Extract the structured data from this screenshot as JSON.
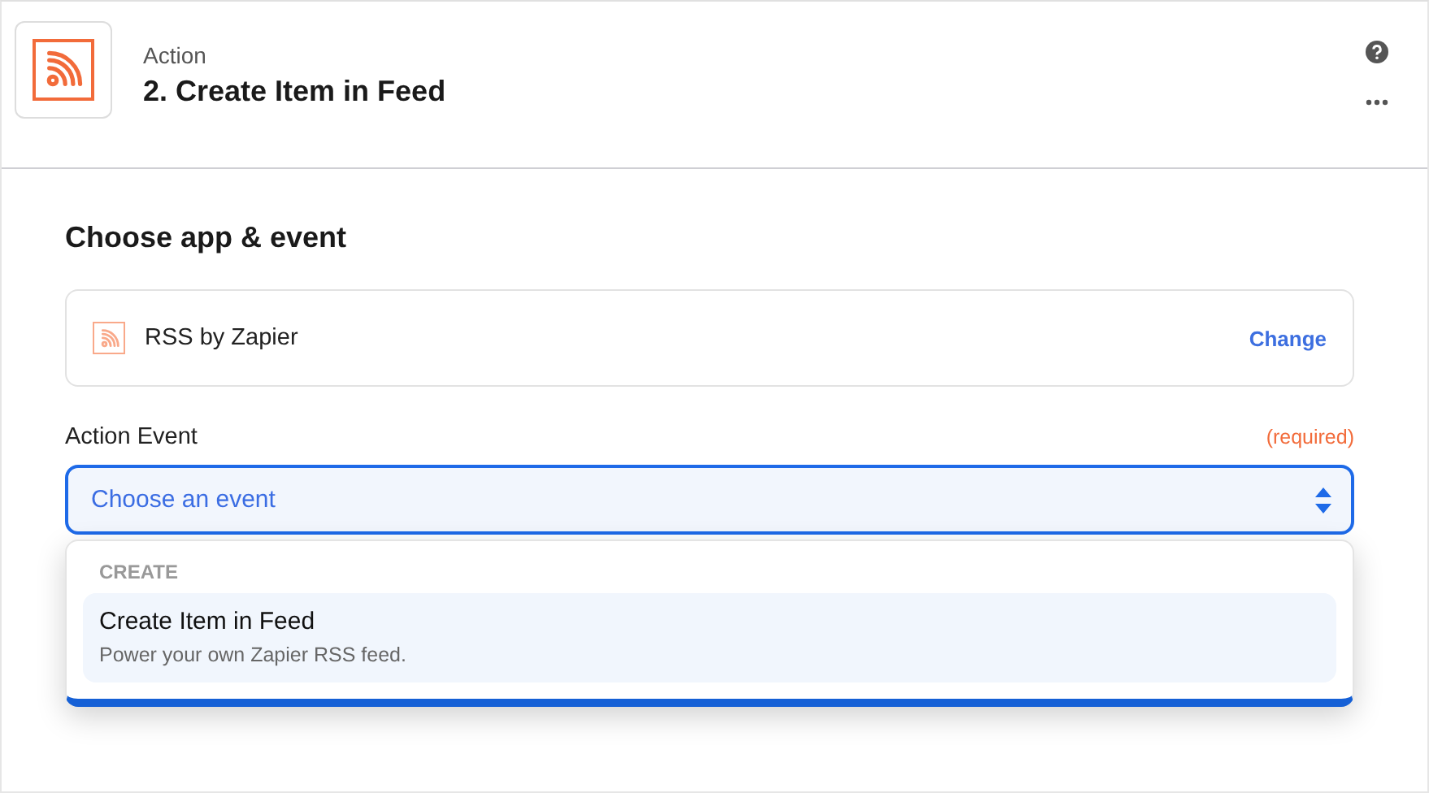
{
  "step": {
    "label": "Action",
    "title": "2. Create Item in Feed"
  },
  "section_title": "Choose app & event",
  "app": {
    "name": "RSS by Zapier",
    "change_link": "Change"
  },
  "field": {
    "label": "Action Event",
    "required_note": "(required)",
    "placeholder": "Choose an event",
    "focused": true
  },
  "dropdown": {
    "groups": [
      {
        "heading": "CREATE",
        "items": [
          {
            "title": "Create Item in Feed",
            "description": "Power your own Zapier RSS feed.",
            "selected": true
          }
        ]
      }
    ]
  }
}
